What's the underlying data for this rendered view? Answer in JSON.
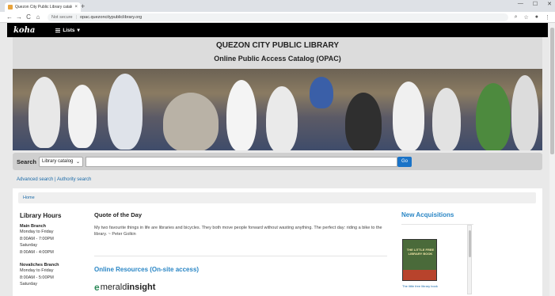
{
  "browser": {
    "tab_title": "Quezon City Public Library catalo",
    "tab_close": "×",
    "new_tab": "+",
    "window_controls": [
      "—",
      "☐",
      "✕"
    ],
    "nav": [
      "←",
      "→",
      "C",
      "⌂"
    ],
    "not_secure": "Not secure",
    "url": "opac.quezoncitypubliclibrary.org",
    "toolbar_icons": [
      "⌕",
      "☆",
      "●",
      "⋮"
    ]
  },
  "navbar": {
    "logo": "koha",
    "lists_label": "Lists",
    "lists_caret": "▾"
  },
  "header": {
    "title": "QUEZON CITY PUBLIC LIBRARY",
    "subtitle": "Online Public Access Catalog (OPAC)"
  },
  "search": {
    "label": "Search",
    "scope": "Library catalog",
    "scope_caret": "⌄",
    "go": "Go"
  },
  "links": {
    "advanced": "Advanced search",
    "separator": " | ",
    "authority": "Authority search"
  },
  "breadcrumb": {
    "home": "Home"
  },
  "hours": {
    "title": "Library Hours",
    "branches": [
      {
        "name": "Main Branch",
        "lines": [
          "Monday to Friday",
          "8:00AM - 7:00PM",
          "Saturday",
          "8:00AM - 4:00PM"
        ]
      },
      {
        "name": "Novaliches Branch",
        "lines": [
          "Monday to Friday",
          "8:00AM - 5:00PM",
          "Saturday"
        ]
      }
    ]
  },
  "quote": {
    "title": "Quote of the Day",
    "text": "My two favourite things in life are libraries and bicycles. They both move people forward without wasting anything. The perfect day: riding a bike to the library. ~ Peter Golkin"
  },
  "online": {
    "title": "Online Resources (On-site access)",
    "logo_e": "e",
    "logo_a": "merald",
    "logo_b": "insight"
  },
  "acquisitions": {
    "title": "New Acquisitions",
    "book_cover_text": "THE LITTLE FREE LIBRARY BOOK",
    "book_label": "The little free library book"
  }
}
